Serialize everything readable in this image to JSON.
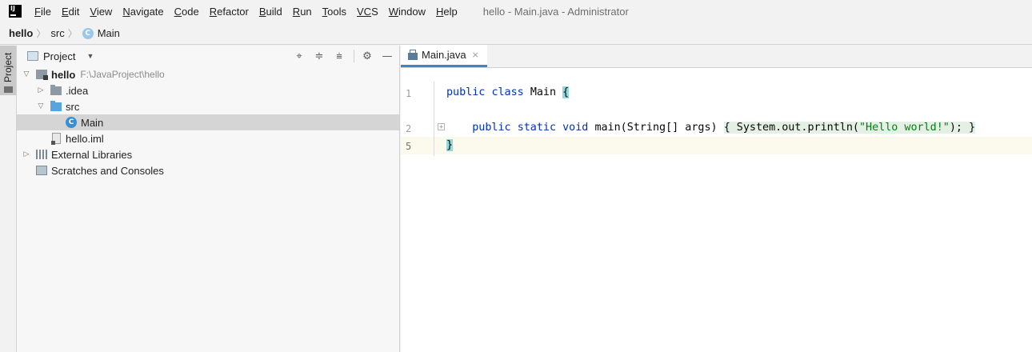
{
  "menubar": {
    "items": [
      {
        "mnemonic": "F",
        "rest": "ile"
      },
      {
        "mnemonic": "E",
        "rest": "dit"
      },
      {
        "mnemonic": "V",
        "rest": "iew"
      },
      {
        "mnemonic": "N",
        "rest": "avigate"
      },
      {
        "mnemonic": "C",
        "rest": "ode"
      },
      {
        "mnemonic": "R",
        "rest": "efactor"
      },
      {
        "mnemonic": "B",
        "rest": "uild"
      },
      {
        "mnemonic": "R",
        "rest": "un"
      },
      {
        "mnemonic": "T",
        "rest": "ools"
      },
      {
        "mnemonic": "VC",
        "rest": "S"
      },
      {
        "mnemonic": "W",
        "rest": "indow"
      },
      {
        "mnemonic": "H",
        "rest": "elp"
      }
    ],
    "window_title": "hello - Main.java - Administrator"
  },
  "breadcrumb": {
    "items": [
      "hello",
      "src",
      "Main"
    ],
    "class_icon_letter": "C"
  },
  "left_stripe": {
    "tab_label": "Project"
  },
  "project_panel": {
    "title": "Project",
    "tree": {
      "root": {
        "label": "hello",
        "path": "F:\\JavaProject\\hello"
      },
      "idea": {
        "label": ".idea"
      },
      "src": {
        "label": "src"
      },
      "main": {
        "label": "Main",
        "icon_letter": "C"
      },
      "iml": {
        "label": "hello.iml"
      },
      "external_libraries": {
        "label": "External Libraries"
      },
      "scratches": {
        "label": "Scratches and Consoles"
      }
    }
  },
  "editor": {
    "tab": {
      "label": "Main.java",
      "close": "×"
    },
    "line_numbers": [
      "1",
      "2",
      "5"
    ],
    "code": {
      "line1": {
        "kw1": "public",
        "kw2": "class",
        "name": "Main ",
        "brace": "{"
      },
      "line2": {
        "kw1": "public",
        "kw2": "static",
        "kw3": "void",
        "sig": "main(String[] args) ",
        "open": "{",
        "call": " System.out.println(",
        "str": "\"Hello world!\"",
        "end": ");",
        "close": " }"
      },
      "line3": {
        "brace": "}"
      }
    }
  },
  "colors": {
    "keyword": "#0033b3",
    "string": "#067d17",
    "accent": "#4083c9",
    "class_icon": "#3b8fd1"
  }
}
